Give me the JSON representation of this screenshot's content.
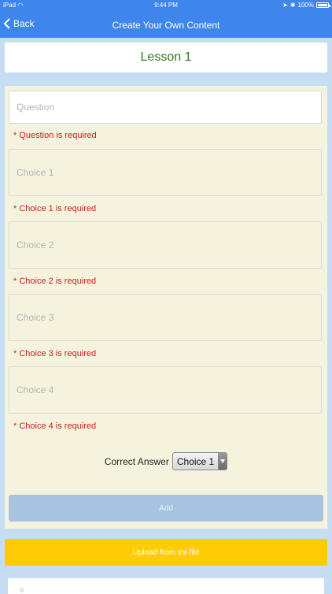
{
  "status_bar": {
    "device": "iPad",
    "wifi_icon": "wifi-icon",
    "time": "9:44 PM",
    "battery_percent": "100%",
    "battery_level": 1.0
  },
  "nav": {
    "back_label": "Back",
    "title": "Create Your Own Content"
  },
  "lesson": {
    "title": "Lesson 1"
  },
  "form": {
    "question_placeholder": "Question",
    "question_error": "* Question is required",
    "choices": [
      {
        "placeholder": "Choice 1",
        "error": "* Choice 1 is required"
      },
      {
        "placeholder": "Choice 2",
        "error": "* Choice 2 is required"
      },
      {
        "placeholder": "Choice 3",
        "error": "* Choice 3 is required"
      },
      {
        "placeholder": "Choice 4",
        "error": "* Choice 4 is required"
      }
    ],
    "correct_answer_label": "Correct Answer",
    "correct_answer_value": "Choice 1",
    "add_label": "Add"
  },
  "upload": {
    "label": "Upload from xsl file"
  },
  "colors": {
    "nav_blue": "#3f86ec",
    "background": "#c6def3",
    "panel": "#f5f3dd",
    "error_red": "#cc1f1f",
    "lesson_green": "#2d7a1d",
    "upload_yellow": "#ffcb05",
    "add_disabled": "#a8c3e2"
  }
}
